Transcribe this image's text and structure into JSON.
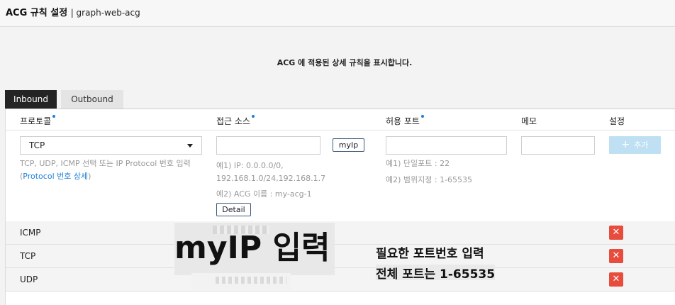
{
  "header": {
    "title": "ACG 규칙 설정",
    "subtitle": "| graph-web-acg"
  },
  "description": "ACG 에 적용된 상세 규칙을 표시합니다.",
  "tabs": [
    {
      "label": "Inbound",
      "active": true
    },
    {
      "label": "Outbound",
      "active": false
    }
  ],
  "columns": {
    "protocol": "프로토콜",
    "source": "접근 소스",
    "port": "허용 포트",
    "memo": "메모",
    "settings": "설정"
  },
  "form": {
    "protocol_selected": "TCP",
    "protocol_help": "TCP, UDP, ICMP 선택 또는 IP Protocol 번호 입력",
    "protocol_link_open": "(",
    "protocol_link": "Protocol 번호 상세",
    "protocol_link_close": ")",
    "source_value": "",
    "myip_label": "myIp",
    "source_help1": "예1) IP: 0.0.0.0/0,",
    "source_help2": "192.168.1.0/24,192.168.1.7",
    "source_help3": "예2) ACG 이름 : my-acg-1",
    "detail_label": "Detail",
    "port_value": "",
    "port_help1": "예1) 단일포트 : 22",
    "port_help2": "예2) 범위지정 : 1-65535",
    "memo_value": "",
    "add_label": "추가"
  },
  "rules": [
    {
      "protocol": "ICMP",
      "delete": "✕"
    },
    {
      "protocol": "TCP",
      "delete": "✕"
    },
    {
      "protocol": "UDP",
      "delete": "✕"
    }
  ],
  "annotations": {
    "myip_note": "myIP 입력",
    "port_note1": "필요한 포트번호 입력",
    "port_note2": "전체 포트는 1-65535"
  },
  "colors": {
    "accent": "#1d7fd8",
    "tab_active": "#242424",
    "delete": "#e74c3c",
    "add_button": "#bfe0f3"
  }
}
